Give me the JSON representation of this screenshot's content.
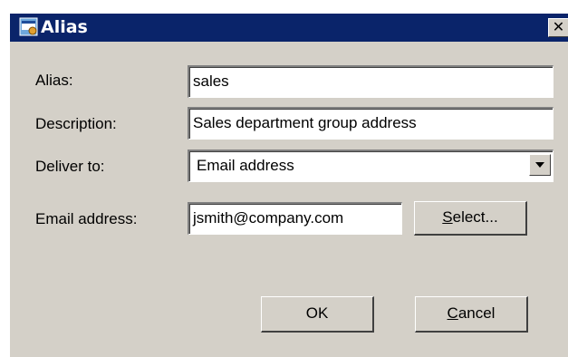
{
  "window": {
    "title": "Alias",
    "close_label": "✕"
  },
  "form": {
    "alias_label": "Alias:",
    "alias_value": "sales",
    "description_label": "Description:",
    "description_value": "Sales department group address",
    "deliver_to_label": "Deliver to:",
    "deliver_to_value": "Email address",
    "email_label": "Email address:",
    "email_value": "jsmith@company.com"
  },
  "buttons": {
    "select_label_first": "S",
    "select_label_rest": "elect...",
    "ok_label": "OK",
    "cancel_label_first": "C",
    "cancel_label_rest": "ancel"
  },
  "colors": {
    "titlebar": "#0a246a",
    "dialog_face": "#d4d0c8"
  },
  "icons": {
    "app": "alias-window-icon",
    "close": "close-icon",
    "dropdown": "chevron-down-icon"
  }
}
